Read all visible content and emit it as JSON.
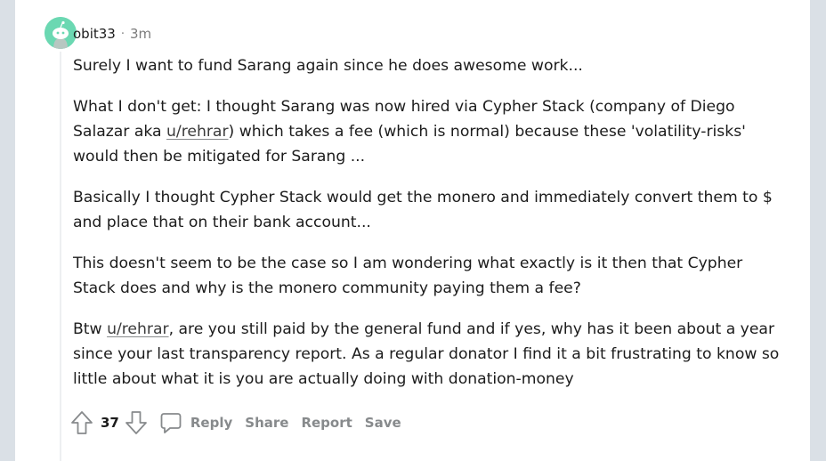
{
  "comment": {
    "author": "obit33",
    "separator": "·",
    "age": "3m",
    "paragraphs": {
      "p1": "Surely I want to fund Sarang again since he does awesome work...",
      "p2_before": "What I don't get: I thought Sarang was now hired via Cypher Stack (company of Diego Salazar aka ",
      "p2_link": "u/rehrar",
      "p2_after": ") which takes a fee (which is normal) because these 'volatility-risks' would then be mitigated for Sarang ...",
      "p3": "Basically I thought Cypher Stack would get the monero and immediately convert them to $ and place that on their bank account...",
      "p4": "This doesn't seem to be the case so I am wondering what exactly is it then that Cypher Stack does and why is the monero community paying them a fee?",
      "p5_before": "Btw ",
      "p5_link": "u/rehrar",
      "p5_after": ", are you still paid by the general fund and if yes, why has it been about a year since your last transparency report. As a regular donator I find it a bit frustrating to know so little about what it is you are actually doing with donation-money"
    },
    "score": "37",
    "actions": {
      "reply": "Reply",
      "share": "Share",
      "report": "Report",
      "save": "Save"
    }
  },
  "colors": {
    "avatar_bg": "#6bd8b2",
    "text": "#1c1c1c",
    "meta": "#7c7c7c",
    "action": "#878a8c",
    "page_bg": "#dae0e6"
  },
  "icons": {
    "avatar": "snoo-avatar-icon",
    "upvote": "upvote-arrow-icon",
    "downvote": "downvote-arrow-icon",
    "reply": "speech-bubble-icon"
  }
}
